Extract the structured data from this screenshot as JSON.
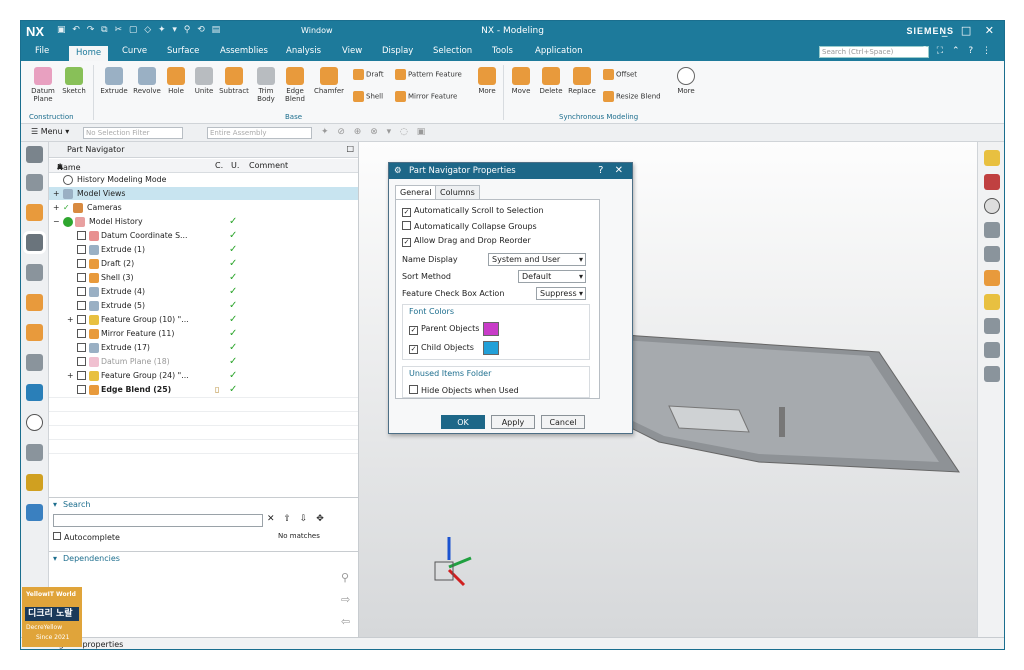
{
  "app": {
    "logo": "NX",
    "window_menu": "Window",
    "title": "NX - Modeling",
    "brand": "SIEMENS"
  },
  "menu": {
    "items": [
      "File",
      "Home",
      "Curve",
      "Surface",
      "Assemblies",
      "Analysis",
      "View",
      "Display",
      "Selection",
      "Tools",
      "Application"
    ],
    "search_placeholder": "Search (Ctrl+Space)"
  },
  "ribbon": {
    "construction": [
      "Datum Plane",
      "Sketch"
    ],
    "construction_group": "Construction",
    "base": [
      "Extrude",
      "Revolve",
      "Hole",
      "Unite",
      "Subtract",
      "Trim Body",
      "Edge Blend",
      "Chamfer"
    ],
    "base_small": [
      "Draft",
      "Pattern Feature",
      "Shell",
      "Mirror Feature"
    ],
    "more": "More",
    "base_group": "Base",
    "sync": [
      "Move",
      "Delete",
      "Replace"
    ],
    "sync_small": [
      "Offset",
      "Resize Blend"
    ],
    "sync_group": "Synchronous Modeling"
  },
  "selbar": {
    "menu": "Menu",
    "filter": "No Selection Filter",
    "assembly": "Entire Assembly"
  },
  "navigator": {
    "title": "Part Navigator",
    "col_name": "Name",
    "col_c": "C.",
    "col_u": "U.",
    "col_comment": "Comment",
    "rows": [
      {
        "label": "History Modeling Mode"
      },
      {
        "label": "Model Views"
      },
      {
        "label": "Cameras"
      },
      {
        "label": "Model History"
      },
      {
        "label": "Datum Coordinate S..."
      },
      {
        "label": "Extrude (1)"
      },
      {
        "label": "Draft (2)"
      },
      {
        "label": "Shell (3)"
      },
      {
        "label": "Extrude (4)"
      },
      {
        "label": "Extrude (5)"
      },
      {
        "label": "Feature Group (10) \"..."
      },
      {
        "label": "Mirror Feature (11)"
      },
      {
        "label": "Extrude (17)"
      },
      {
        "label": "Datum Plane (18)"
      },
      {
        "label": "Feature Group (24) \"..."
      },
      {
        "label": "Edge Blend (25)"
      }
    ],
    "search_title": "Search",
    "autocomplete": "Autocomplete",
    "no_matches": "No matches",
    "dependencies": "Dependencies"
  },
  "dialog": {
    "title": "Part Navigator Properties",
    "tabs": [
      "General",
      "Columns"
    ],
    "checks": [
      "Automatically Scroll to Selection",
      "Automatically Collapse Groups",
      "Allow Drag and Drop Reorder"
    ],
    "name_display_label": "Name Display",
    "name_display_value": "System and User",
    "sort_label": "Sort Method",
    "sort_value": "Default",
    "fcb_label": "Feature Check Box Action",
    "fcb_value": "Suppress",
    "font_colors": "Font Colors",
    "parent": "Parent Objects",
    "child": "Child Objects",
    "parent_color": "#c83cc8",
    "child_color": "#22a0d8",
    "unused_folder": "Unused Items Folder",
    "hide_unused": "Hide Objects when Used",
    "ok": "OK",
    "apply": "Apply",
    "cancel": "Cancel"
  },
  "status": {
    "text": "Set navigator properties"
  },
  "watermark": {
    "line1": "YellowIT World",
    "line2": "디크리 노랄",
    "line3": "DecreYellow",
    "line4": "Since 2021"
  }
}
